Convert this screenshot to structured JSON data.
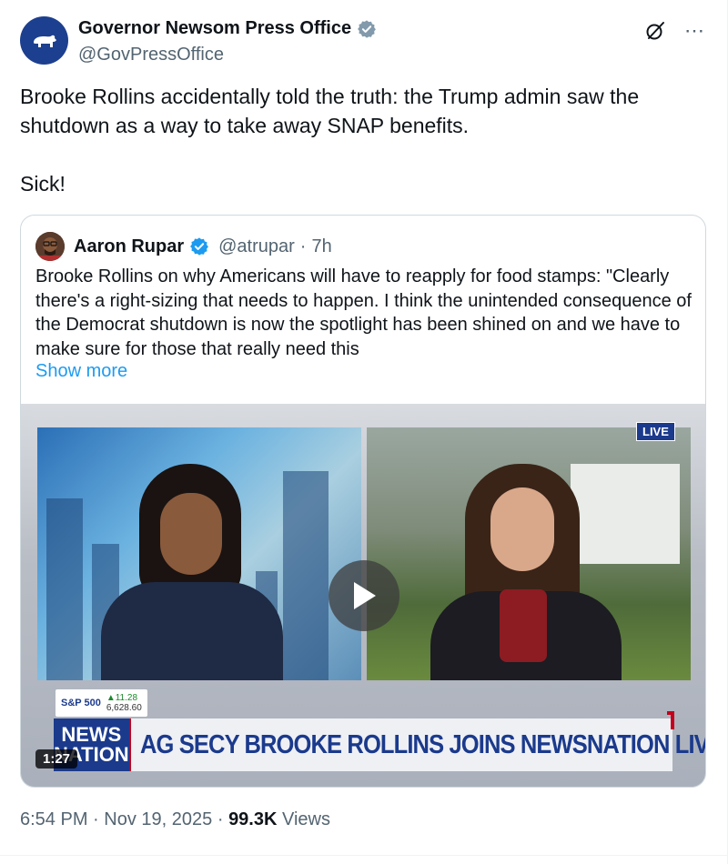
{
  "post": {
    "author_name": "Governor Newsom Press Office",
    "author_handle": "@GovPressOffice",
    "text_paragraph_1": "Brooke Rollins accidentally told the truth: the Trump admin saw the shutdown as a way to take away SNAP benefits.",
    "text_paragraph_2": "Sick!",
    "time": "6:54 PM",
    "separator": "·",
    "date": "Nov 19, 2025",
    "views_count": "99.3K",
    "views_label": "Views",
    "more_icon": "⋯"
  },
  "quote": {
    "author_name": "Aaron Rupar",
    "author_handle": "@atrupar",
    "time_sep": "·",
    "time": "7h",
    "text": "Brooke Rollins on why Americans will have to reapply for food stamps: \"Clearly there's a right-sizing that needs to happen. I think the unintended consequence of the Democrat shutdown is now the spotlight has been shined on and we have to make sure for those that really need this",
    "show_more": "Show more"
  },
  "video": {
    "live_badge": "LIVE",
    "ticker_name": "S&P 500",
    "ticker_change": "▲11.28",
    "ticker_value": "6,628.60",
    "logo_line_1": "NEWS",
    "logo_line_2": "NATION",
    "headline": "AG SECY BROOKE ROLLINS JOINS NEWSNATION LIVE",
    "duration": "1:27"
  },
  "colors": {
    "verified_gray": "#829aab",
    "verified_blue": "#1d9bf0",
    "link_blue": "#1d9bf0",
    "newsnation_blue": "#1b3a8c"
  },
  "icons": {
    "avatar_main": "california-bear-icon",
    "verified_main": "verified-gray-icon",
    "grok": "grok-icon",
    "more": "more-icon",
    "verified_quote": "verified-blue-icon",
    "play": "play-icon"
  }
}
